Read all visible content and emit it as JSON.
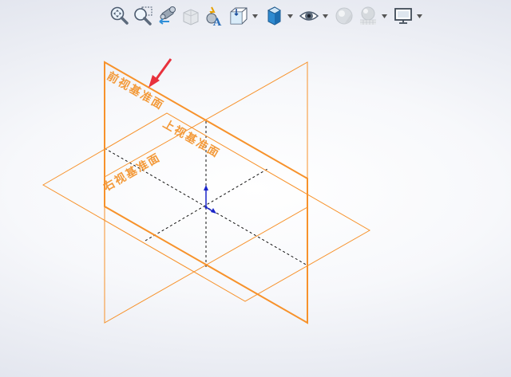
{
  "toolbar": {
    "items": [
      {
        "name": "zoom-to-fit",
        "icon": "zoom-fit-icon",
        "dropdown": false
      },
      {
        "name": "zoom-to-area",
        "icon": "zoom-area-icon",
        "dropdown": false
      },
      {
        "name": "previous-view",
        "icon": "previous-view-icon",
        "dropdown": false
      },
      {
        "name": "section-view",
        "icon": "section-view-icon",
        "dropdown": false
      },
      {
        "name": "dynamic-annotation-views",
        "icon": "annotation-views-icon",
        "dropdown": false
      },
      {
        "name": "view-orientation",
        "icon": "view-orientation-icon",
        "dropdown": true
      },
      {
        "name": "display-style",
        "icon": "display-style-icon",
        "dropdown": true
      },
      {
        "name": "hide-show-items",
        "icon": "eye-icon",
        "dropdown": true
      },
      {
        "name": "edit-appearance",
        "icon": "appearance-icon",
        "dropdown": false
      },
      {
        "name": "apply-scene",
        "icon": "scene-icon",
        "dropdown": true
      },
      {
        "name": "view-settings",
        "icon": "monitor-icon",
        "dropdown": true
      }
    ]
  },
  "planes": {
    "front": {
      "label": "前视基准面"
    },
    "top": {
      "label": "上视基准面"
    },
    "right": {
      "label": "右视基准面"
    }
  },
  "colors": {
    "plane_edge": "#f7922b",
    "plane_label": "#f39a3a",
    "annotation_arrow": "#e8313c",
    "origin_axis": "#1a25c9",
    "hidden_line": "#111111"
  }
}
